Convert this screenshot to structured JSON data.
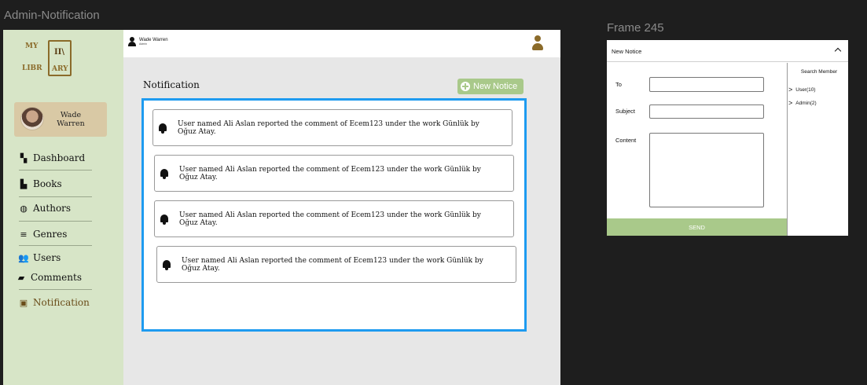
{
  "frame_labels": {
    "admin": "Admin-Notification",
    "frame": "Frame 245"
  },
  "logo": {
    "my": "MY",
    "libr": "LIBR",
    "ary": "ARY"
  },
  "profile": {
    "name": "Wade Warren"
  },
  "sidebar": {
    "items": [
      {
        "label": "Dashboard",
        "icon": "dashboard-icon"
      },
      {
        "label": "Books",
        "icon": "books-icon"
      },
      {
        "label": "Authors",
        "icon": "authors-icon"
      },
      {
        "label": "Genres",
        "icon": "genres-icon"
      },
      {
        "label": "Users",
        "icon": "users-icon"
      },
      {
        "label": "Comments",
        "icon": "comments-icon"
      },
      {
        "label": "Notification",
        "icon": "notification-icon",
        "active": true
      }
    ]
  },
  "topbar": {
    "user_name": "Wade Warren",
    "user_role": "Admin"
  },
  "main": {
    "title": "Notification",
    "new_notice_label": "New Notice",
    "notifications": [
      {
        "text": "User named Ali Aslan reported the comment of Ecem123 under the work Günlük by Oğuz Atay."
      },
      {
        "text": "User named Ali Aslan reported the comment of Ecem123 under the work Günlük by Oğuz Atay."
      },
      {
        "text": "User named Ali Aslan reported the comment of Ecem123 under the work Günlük by Oğuz Atay."
      },
      {
        "text": "User named Ali Aslan reported the comment of Ecem123 under the work Günlük by Oğuz Atay."
      }
    ]
  },
  "new_notice_form": {
    "title": "New Notice",
    "to_label": "To",
    "subject_label": "Subject",
    "content_label": "Content",
    "send_label": "SEND",
    "search_member_label": "Search Member",
    "groups": [
      {
        "label": "User(10)"
      },
      {
        "label": "Admin(2)"
      }
    ]
  },
  "colors": {
    "sidebar_bg": "#d7e5c7",
    "accent_green": "#a9c98a",
    "panel_border": "#1e9bf0",
    "brand_brown": "#8b6b2a"
  }
}
